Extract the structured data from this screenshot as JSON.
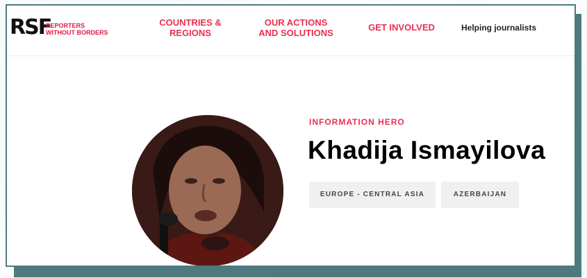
{
  "header": {
    "logo_mark": "RSF",
    "logo_text_line1": "REPORTERS",
    "logo_text_line2": "WITHOUT BORDERS",
    "nav": [
      {
        "line1": "COUNTRIES &",
        "line2": "REGIONS"
      },
      {
        "line1": "OUR ACTIONS",
        "line2": "AND SOLUTIONS"
      },
      {
        "label": "GET INVOLVED"
      },
      {
        "label": "Helping journalists"
      }
    ]
  },
  "profile": {
    "category": "INFORMATION HERO",
    "name": "Khadija Ismayilova",
    "tags": [
      "EUROPE - CENTRAL ASIA",
      "AZERBAIJAN"
    ]
  },
  "colors": {
    "accent": "#e8304f",
    "frame": "#4e7a7f",
    "tag_bg": "#f0f0f0"
  }
}
